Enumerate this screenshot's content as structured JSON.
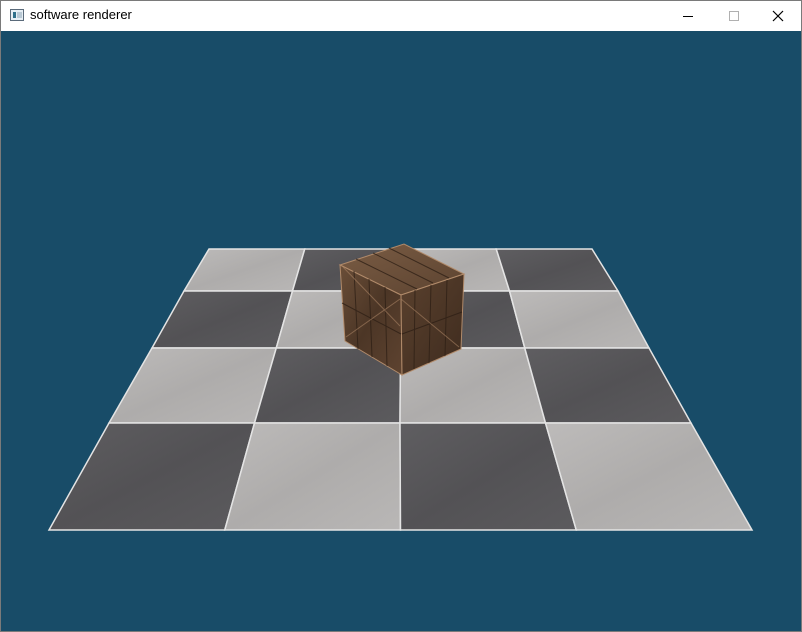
{
  "window": {
    "title": "software renderer",
    "controls": {
      "minimize": "minimize-icon",
      "maximize": "maximize-icon",
      "close": "close-icon"
    }
  },
  "scene": {
    "background_color": "#184c68",
    "floor": {
      "grid_rows": 4,
      "grid_cols": 4,
      "light_tile_color": "#b3b1b0",
      "dark_tile_color": "#58575a",
      "grout_color": "#e4e4e4"
    },
    "crate": {
      "color": "#5b4230",
      "highlight_color": "#b08a6a"
    }
  }
}
